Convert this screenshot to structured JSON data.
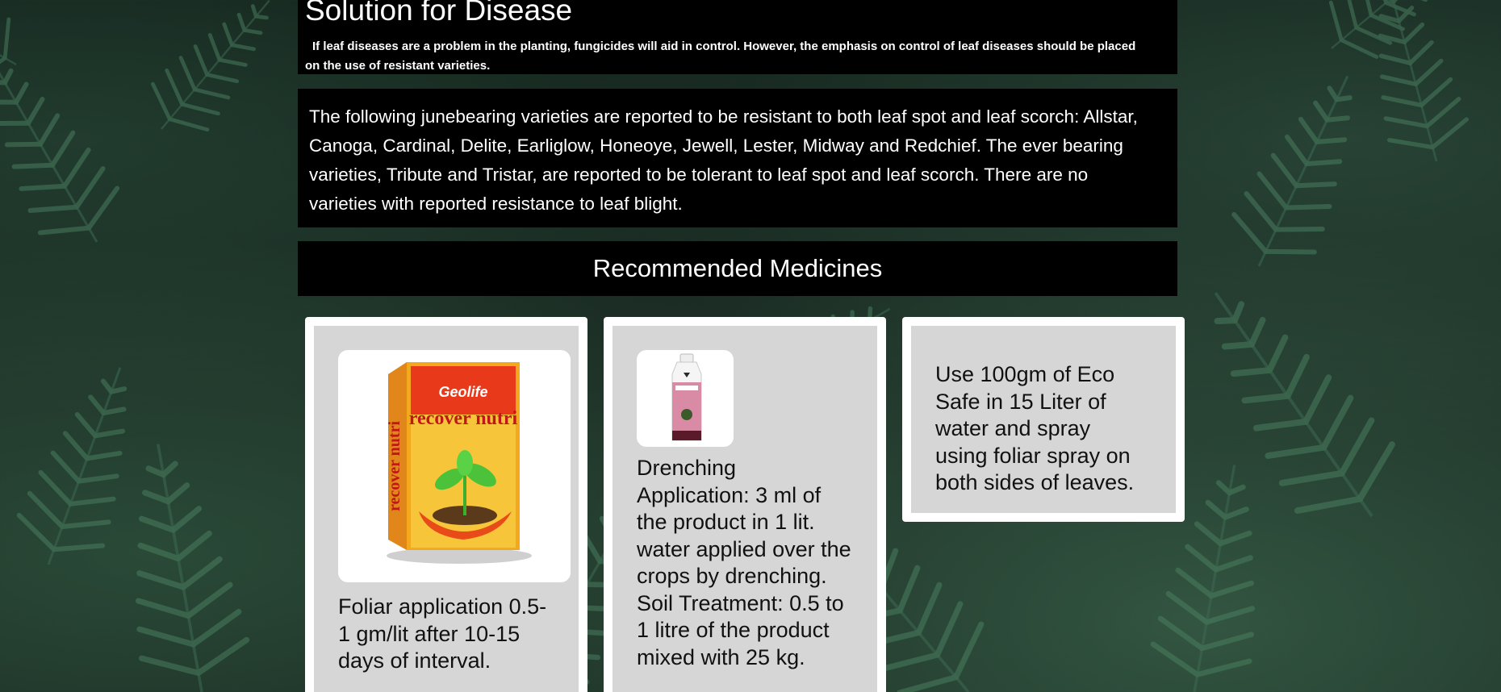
{
  "page": {
    "title": "Solution for Disease",
    "intro": "If leaf diseases are a problem in the planting, fungicides will aid in control. However, the emphasis on control of leaf diseases should be placed on the use of resistant varieties.",
    "varieties": "The following junebearing varieties are reported to be resistant to both leaf spot and leaf scorch: Allstar, Canoga, Cardinal, Delite, Earliglow, Honeoye, Jewell, Lester, Midway and Redchief. The ever bearing varieties, Tribute and Tristar, are reported to be tolerant to leaf spot and leaf scorch. There are no varieties with reported resistance to leaf blight."
  },
  "medicines": {
    "heading": "Recommended Medicines",
    "items": [
      {
        "image_icon": "recover-nutri-box-image",
        "box_brand": "Geolife",
        "box_name": "recover nutri",
        "description": "Foliar application 0.5-1 gm/lit after 10-15 days of interval."
      },
      {
        "image_icon": "fungicide-bottle-image",
        "description": "Drenching Application: 3 ml of the product in 1 lit. water applied over the crops by drenching. Soil Treatment: 0.5 to 1 litre of the product mixed with 25 kg."
      },
      {
        "description": "Use 100gm of Eco Safe in 15 Liter of water and spray using foliar spray on both sides of leaves."
      }
    ]
  },
  "colors": {
    "panel_background": "#000000",
    "card_background": "#ffffff",
    "card_inner_background": "#d6d6d6",
    "text_light": "#ffffff",
    "text_dark": "#111111"
  }
}
